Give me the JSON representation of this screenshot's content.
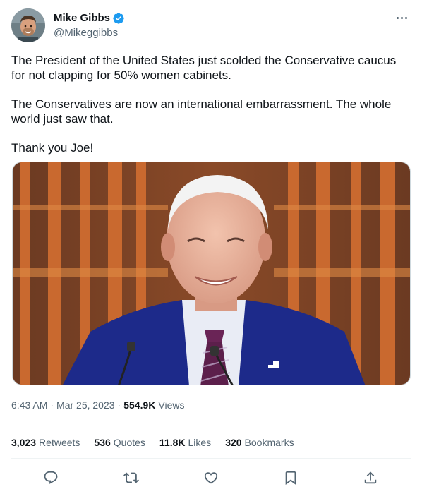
{
  "author": {
    "display_name": "Mike Gibbs",
    "handle": "@Mikeggibbs",
    "verified": true,
    "verified_color": "#1d9bf0"
  },
  "tweet": {
    "paragraphs": [
      "The President of the United States just scolded the Conservative caucus for not clapping for 50% women cabinets.",
      "The Conservatives are now an international embarrassment. The whole world just saw that.",
      "Thank you Joe!"
    ]
  },
  "meta": {
    "time": "6:43 AM",
    "separator_1": "·",
    "date": "Mar 25, 2023",
    "separator_2": "·",
    "views_count": "554.9K",
    "views_label": "Views"
  },
  "stats": {
    "retweets": {
      "count": "3,023",
      "label": "Retweets"
    },
    "quotes": {
      "count": "536",
      "label": "Quotes"
    },
    "likes": {
      "count": "11.8K",
      "label": "Likes"
    },
    "bookmarks": {
      "count": "320",
      "label": "Bookmarks"
    }
  },
  "actions": [
    {
      "name": "reply-icon"
    },
    {
      "name": "retweet-icon"
    },
    {
      "name": "like-icon"
    },
    {
      "name": "bookmark-icon"
    },
    {
      "name": "share-icon"
    }
  ],
  "colors": {
    "text_primary": "#0f1419",
    "text_secondary": "#536471",
    "divider": "#eff3f4"
  }
}
